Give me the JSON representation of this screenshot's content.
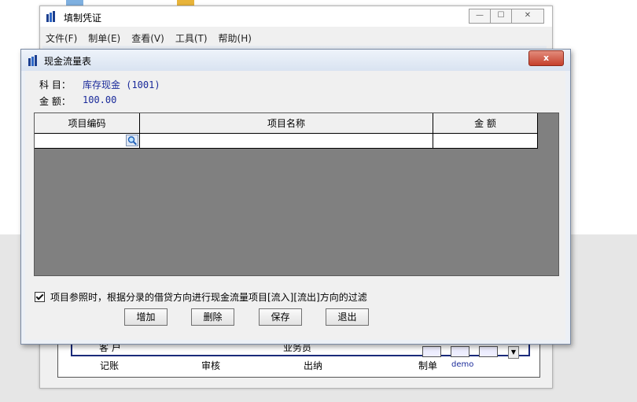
{
  "desktop": {
    "background_color": "#e6e6e6"
  },
  "bg_window": {
    "title": "填制凭证",
    "menu": [
      "文件(F)",
      "制单(E)",
      "查看(V)",
      "工具(T)",
      "帮助(H)"
    ],
    "voucher": {
      "customer_label": "客 户",
      "salesperson_label": "业务员",
      "footer": {
        "bookkeeping": "记账",
        "review": "审核",
        "cashier": "出纳",
        "maker": "制单",
        "maker_value": "demo"
      }
    }
  },
  "dialog": {
    "title": "现金流量表",
    "close_glyph": "x",
    "subject_label": "科 目：",
    "subject_value": "库存现金 (1001)",
    "amount_label": "金 额：",
    "amount_value": "100.00",
    "table": {
      "columns": [
        "项目编码",
        "项目名称",
        "金 额"
      ],
      "rows": [
        [
          "",
          "",
          ""
        ]
      ]
    },
    "filter": {
      "checked": true,
      "label": "项目参照时，根据分录的借贷方向进行现金流量项目[流入][流出]方向的过滤"
    },
    "buttons": {
      "add": "增加",
      "delete": "删除",
      "save": "保存",
      "exit": "退出"
    }
  },
  "colors": {
    "accent": "#1a2a9a",
    "close_red": "#c5402c",
    "grid_empty": "#808080"
  }
}
